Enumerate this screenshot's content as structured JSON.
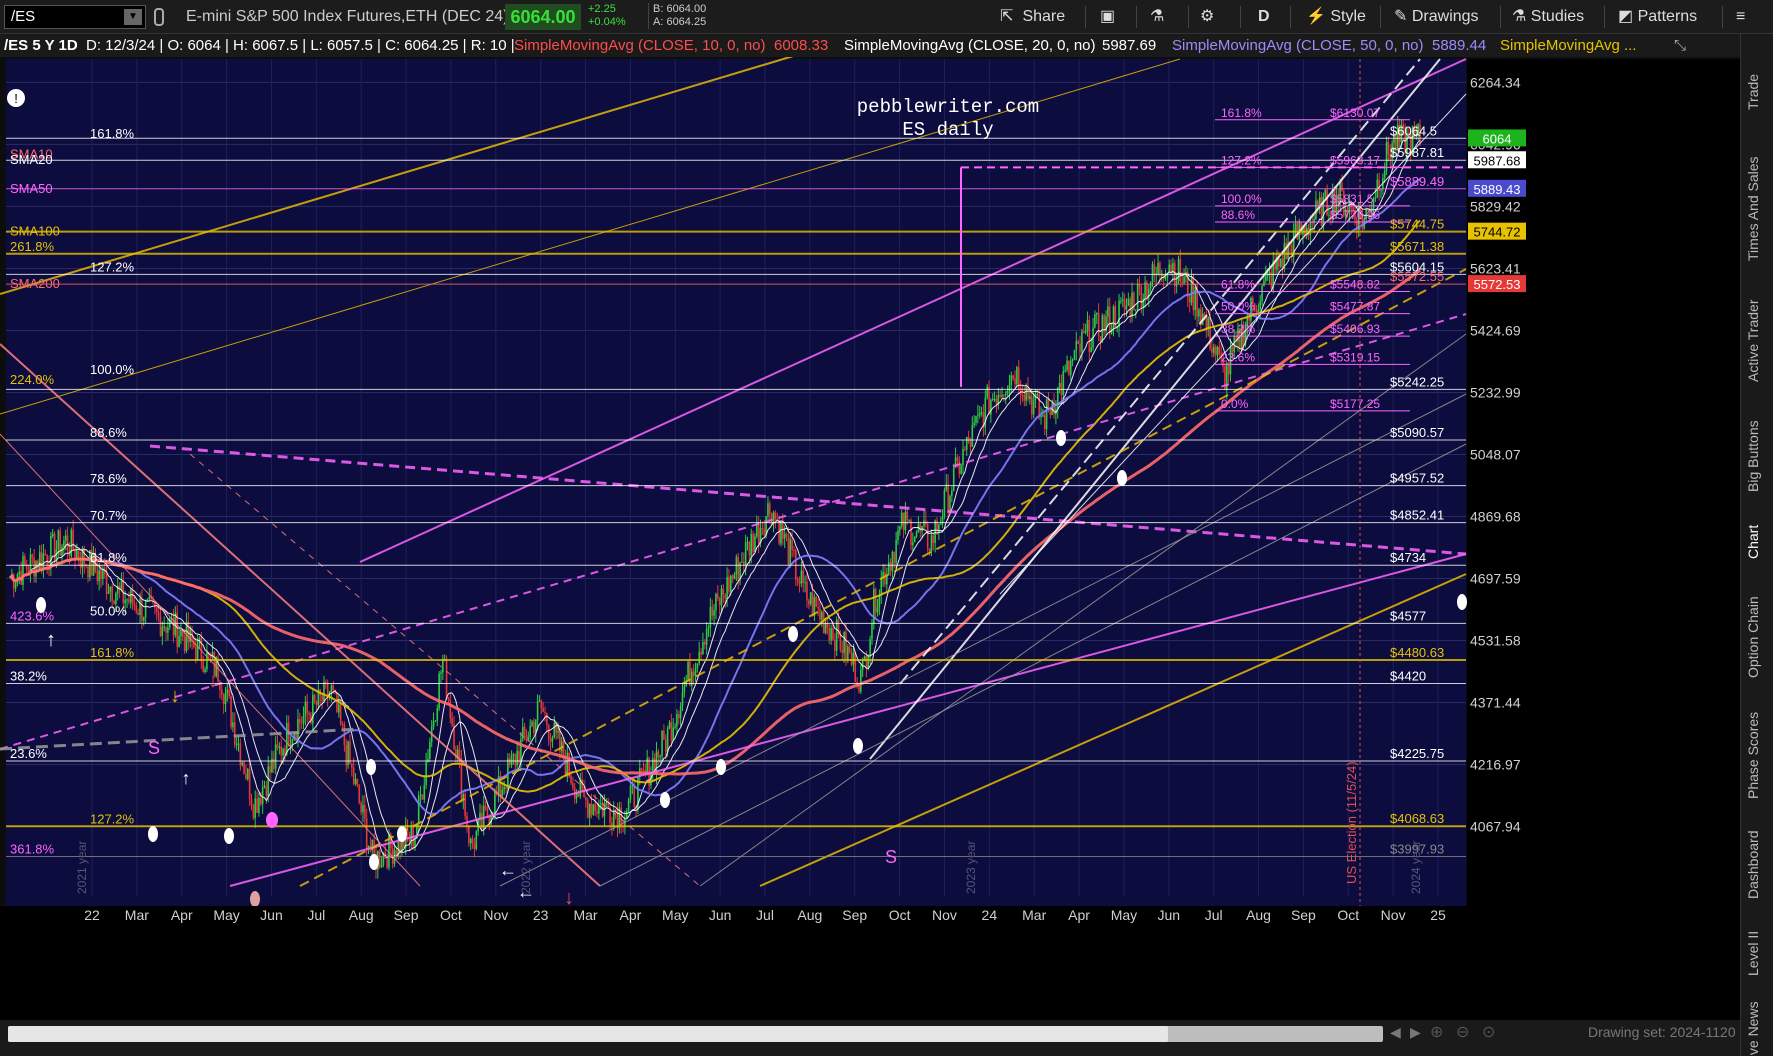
{
  "toolbar": {
    "symbol": "/ES",
    "instrument_name": "E-mini S&P 500 Index Futures,ETH (DEC 24)",
    "last_price": "6064.00",
    "change": "+2.25",
    "change_pct": "+0.04%",
    "bid": "B: 6064.00",
    "ask": "A: 6064.25",
    "share_label": "Share",
    "aggregation": "D",
    "style_label": "Style",
    "drawings_label": "Drawings",
    "studies_label": "Studies",
    "patterns_label": "Patterns"
  },
  "study_header": {
    "symbol_period": "/ES 5 Y 1D",
    "ohlc": "D: 12/3/24 | O: 6064 | H: 6067.5 | L: 6057.5 | C: 6064.25 | R: 10 |",
    "sma10_label": "SimpleMovingAvg (CLOSE, 10, 0, no)",
    "sma10_value": "6008.33",
    "sma20_label": "SimpleMovingAvg (CLOSE, 20, 0, no)",
    "sma20_value": "5987.69",
    "sma50_label": "SimpleMovingAvg (CLOSE, 50, 0, no)",
    "sma50_value": "5889.44",
    "sma_more_label": "SimpleMovingAvg ..."
  },
  "colors": {
    "background": "#0c0c3e",
    "up_candle": "#2ecc40",
    "down_candle": "#e53935",
    "sma10": "#ffffff",
    "sma20": "#ffffff",
    "sma50": "#8080ff",
    "sma100": "#e6c200",
    "sma200": "#ff6b6b",
    "magenta": "#ff66ff",
    "gold": "#e6b800",
    "price_box_green": "#1db31d"
  },
  "chart_data": {
    "type": "candlestick",
    "title": "pebblewriter.com",
    "subtitle": "ES daily",
    "y_axis_ticks": [
      "6264.34",
      "6042.96",
      "5829.42",
      "5623.41",
      "5424.69",
      "5232.99",
      "5048.07",
      "4869.68",
      "4697.59",
      "4531.58",
      "4371.44",
      "4216.97",
      "4067.94"
    ],
    "x_axis_ticks": [
      "22",
      "Mar",
      "Apr",
      "May",
      "Jun",
      "Jul",
      "Aug",
      "Sep",
      "Oct",
      "Nov",
      "23",
      "Mar",
      "Apr",
      "May",
      "Jun",
      "Jul",
      "Aug",
      "Sep",
      "Oct",
      "Nov",
      "24",
      "Mar",
      "Apr",
      "May",
      "Jun",
      "Jul",
      "Aug",
      "Sep",
      "Oct",
      "Nov",
      "25"
    ],
    "ylim": [
      3930,
      6350
    ],
    "log_scale": true,
    "year_markers": [
      "2021 year",
      "2022 year",
      "2023 year",
      "2024 year"
    ],
    "event_marker": "US Election (11/5/24)",
    "price_boxes": [
      {
        "label": "6064",
        "value": 6064,
        "color": "#1db31d",
        "text_color": "#ffffff"
      },
      {
        "label": "5987.68",
        "value": 5987.68,
        "color": "#ffffff",
        "text_color": "#000000"
      },
      {
        "label": "5889.43",
        "value": 5889.43,
        "color": "#4a4acf",
        "text_color": "#ffffff"
      },
      {
        "label": "5744.72",
        "value": 5744.72,
        "color": "#e6c200",
        "text_color": "#000000"
      },
      {
        "label": "5572.53",
        "value": 5572.53,
        "color": "#e53935",
        "text_color": "#ffffff"
      }
    ],
    "sma_labels": [
      {
        "label": "SMA10",
        "value": 6008,
        "color": "#ff6b6b"
      },
      {
        "label": "SMA20",
        "value": 5988,
        "color": "#ffffff"
      },
      {
        "label": "SMA50",
        "value": 5889,
        "color": "#ff66ff"
      },
      {
        "label": "SMA100",
        "value": 5745,
        "color": "#e6c200"
      },
      {
        "label": "SMA200",
        "value": 5573,
        "color": "#ff6b6b"
      }
    ],
    "left_fib_levels": [
      {
        "label": "161.8%",
        "value": 6055,
        "color": "#ffffff"
      },
      {
        "label": "261.8%",
        "value": 5671,
        "color": "#e6c200"
      },
      {
        "label": "127.2%",
        "value": 5604,
        "color": "#ffffff"
      },
      {
        "label": "224.0%",
        "value": 5250,
        "color": "#e6c200"
      },
      {
        "label": "100.0%",
        "value": 5280,
        "color": "#ffffff"
      },
      {
        "label": "88.6%",
        "value": 5090,
        "color": "#ffffff"
      },
      {
        "label": "78.6%",
        "value": 4957,
        "color": "#ffffff"
      },
      {
        "label": "70.7%",
        "value": 4852,
        "color": "#ffffff"
      },
      {
        "label": "61.8%",
        "value": 4734,
        "color": "#ffffff"
      },
      {
        "label": "423.6%",
        "value": 4577,
        "color": "#ff66ff"
      },
      {
        "label": "50.0%",
        "value": 4590,
        "color": "#ffffff"
      },
      {
        "label": "161.8%",
        "value": 4480,
        "color": "#e6c200"
      },
      {
        "label": "38.2%",
        "value": 4420,
        "color": "#ffffff"
      },
      {
        "label": "23.6%",
        "value": 4225,
        "color": "#ffffff"
      },
      {
        "label": "127.2%",
        "value": 4068,
        "color": "#e6c200"
      },
      {
        "label": "361.8%",
        "value": 3998,
        "color": "#ff66ff"
      }
    ],
    "right_levels": [
      {
        "label": "$6064.5",
        "value": 6064.5,
        "color": "#ffffff"
      },
      {
        "label": "$5987.81",
        "value": 5987.81,
        "color": "#ffffff"
      },
      {
        "label": "$5889.49",
        "value": 5889.49,
        "color": "#ff66ff"
      },
      {
        "label": "$5744.75",
        "value": 5744.75,
        "color": "#e6c200"
      },
      {
        "label": "$5671.38",
        "value": 5671.38,
        "color": "#e6c200"
      },
      {
        "label": "$5604.15",
        "value": 5604.15,
        "color": "#ffffff"
      },
      {
        "label": "$5572.55",
        "value": 5572.55,
        "color": "#ff6b6b"
      },
      {
        "label": "$5242.25",
        "value": 5242.25,
        "color": "#ffffff"
      },
      {
        "label": "$5090.57",
        "value": 5090.57,
        "color": "#ffffff"
      },
      {
        "label": "$4957.52",
        "value": 4957.52,
        "color": "#ffffff"
      },
      {
        "label": "$4852.41",
        "value": 4852.41,
        "color": "#ffffff"
      },
      {
        "label": "$4734",
        "value": 4734,
        "color": "#ffffff"
      },
      {
        "label": "$4577",
        "value": 4577,
        "color": "#ffffff"
      },
      {
        "label": "$4480.63",
        "value": 4480.63,
        "color": "#e6c200"
      },
      {
        "label": "$4420",
        "value": 4420,
        "color": "#ffffff"
      },
      {
        "label": "$4225.75",
        "value": 4225.75,
        "color": "#ffffff"
      },
      {
        "label": "$4068.63",
        "value": 4068.63,
        "color": "#e6c200"
      },
      {
        "label": "$3997.93",
        "value": 3997.93,
        "color": "#888888"
      }
    ],
    "recent_fib_levels": [
      {
        "pct": "161.8%",
        "price": "$6130.07",
        "value": 6130.07
      },
      {
        "pct": "127.2%",
        "price": "$5963.17",
        "value": 5963.17
      },
      {
        "pct": "100.0%",
        "price": "$5831.5",
        "value": 5831.5
      },
      {
        "pct": "88.6%",
        "price": "$5776.96",
        "value": 5776.96
      },
      {
        "pct": "61.8%",
        "price": "$5548.82",
        "value": 5548.82
      },
      {
        "pct": "50.0%",
        "price": "$5477.87",
        "value": 5477.87
      },
      {
        "pct": "38.2%",
        "price": "$5406.93",
        "value": 5406.93
      },
      {
        "pct": "23.6%",
        "price": "$5319.15",
        "value": 5319.15
      },
      {
        "pct": "0.0%",
        "price": "$5177.25",
        "value": 5177.25
      }
    ],
    "annotation_letters": [
      "S",
      "S"
    ]
  },
  "sidebar": {
    "tabs": [
      "Trade",
      "Times And Sales",
      "Active Trader",
      "Big Buttons",
      "Chart",
      "Option Chain",
      "Phase Scores",
      "Dashboard",
      "Level II",
      "Live News"
    ]
  },
  "bottom": {
    "drawing_set": "Drawing set: 2024-1120"
  }
}
